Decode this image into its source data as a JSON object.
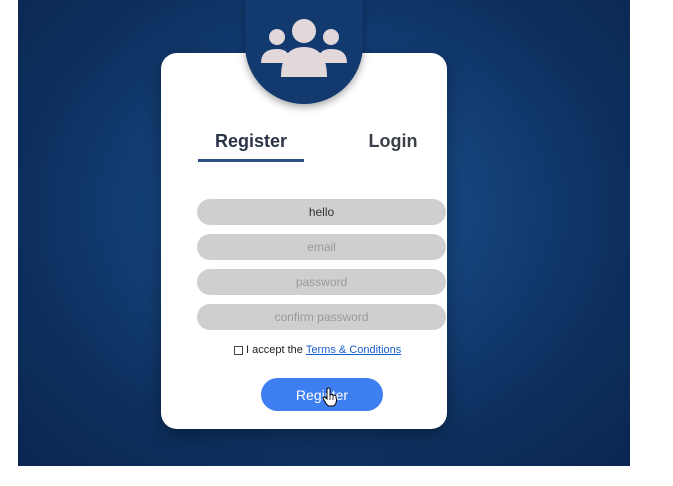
{
  "tabs": {
    "register_label": "Register",
    "login_label": "Login"
  },
  "form": {
    "username_value": "hello",
    "email_placeholder": "email",
    "password_placeholder": "password",
    "confirm_placeholder": "confirm password",
    "terms_prefix": "I accept the",
    "terms_link": "Terms & Conditions",
    "terms_checked": false,
    "submit_label": "Register"
  },
  "icons": {
    "badge": "users-group-icon",
    "cursor": "hand-pointer-icon"
  },
  "colors": {
    "background": "#123a6f",
    "tab_underline": "#2c4f86",
    "field_bg": "#cfcfcf",
    "button": "#3d7ff0",
    "link": "#1a5fcf"
  }
}
